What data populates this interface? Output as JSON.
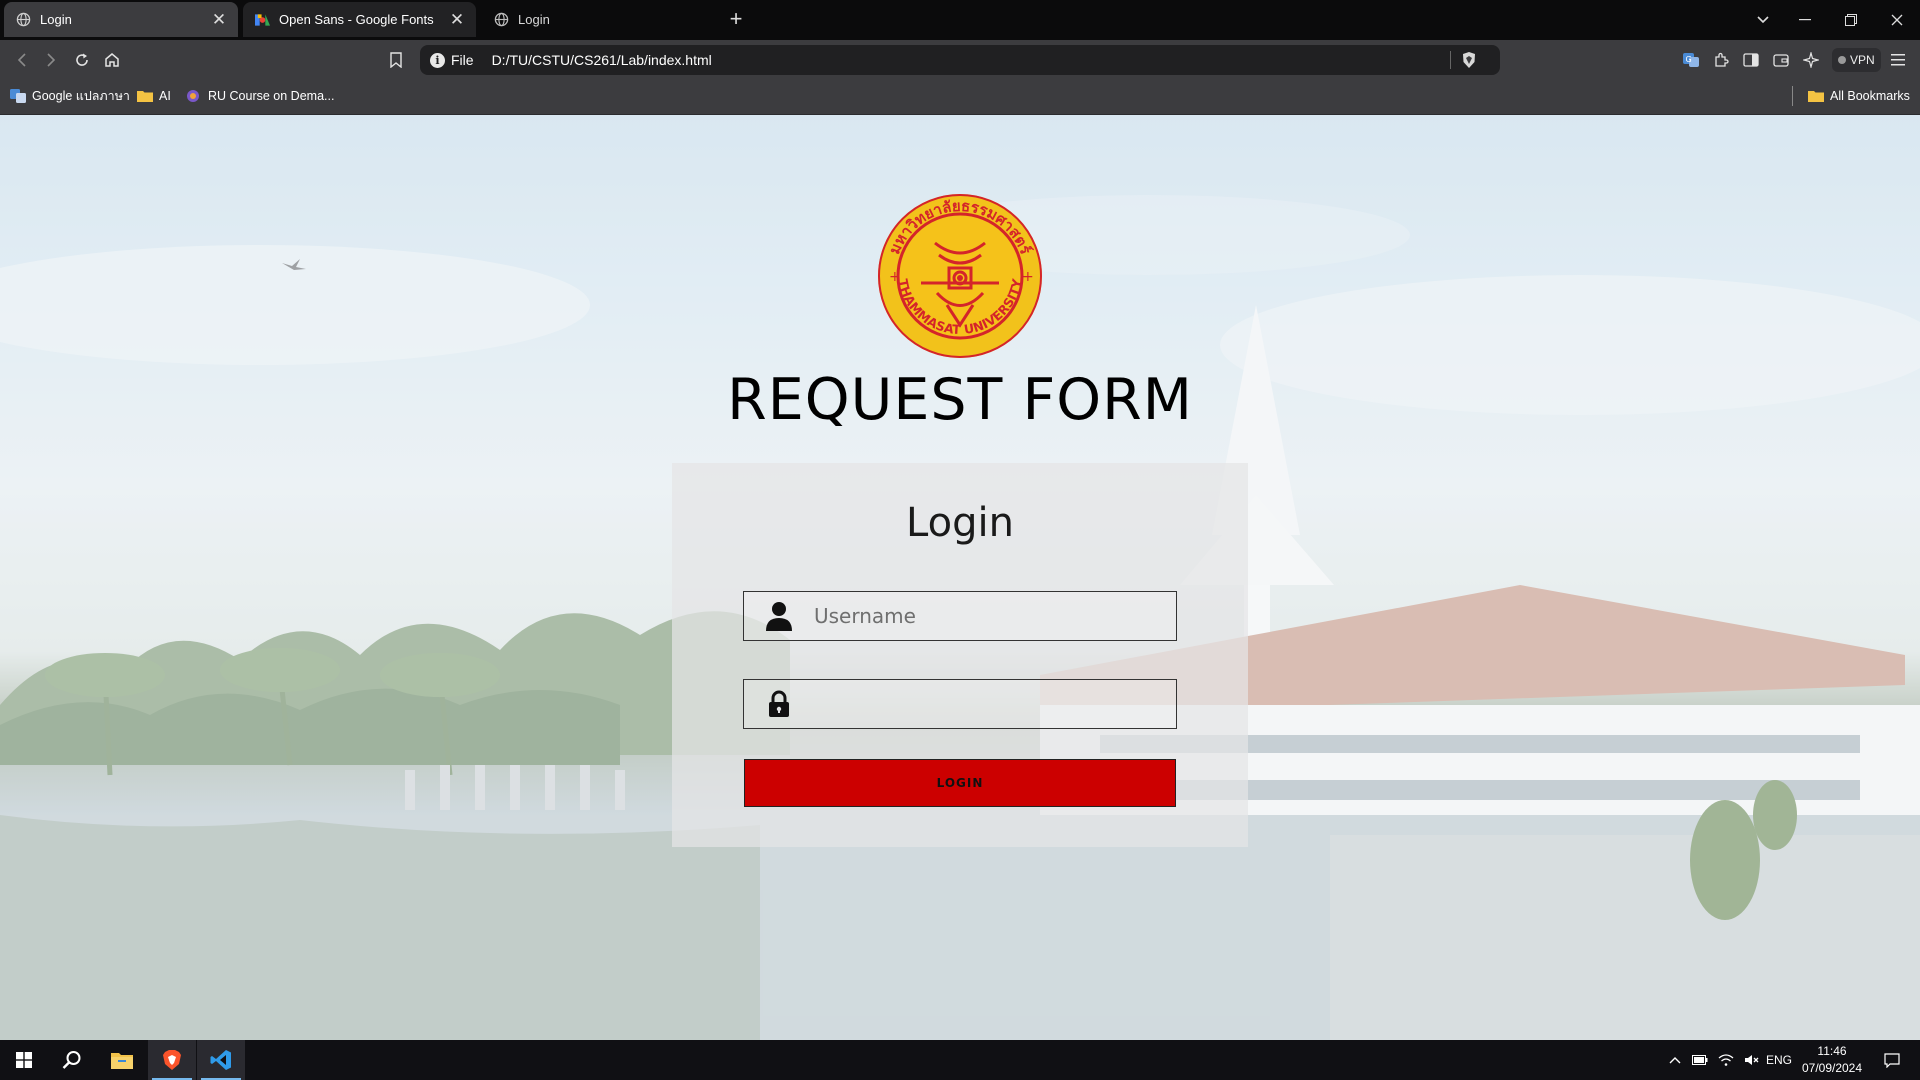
{
  "browser": {
    "tabs": [
      {
        "label": "Login",
        "active": true
      },
      {
        "label": "Open Sans - Google Fonts",
        "active": false
      },
      {
        "label": "Login",
        "active": false
      }
    ],
    "address": {
      "scheme_label": "File",
      "url": "D:/TU/CSTU/CS261/Lab/index.html"
    },
    "vpn_label": "VPN",
    "bookmarks": [
      {
        "label": "Google แปลภาษา",
        "icon": "google-translate-icon"
      },
      {
        "label": "AI",
        "icon": "folder-icon"
      },
      {
        "label": "RU Course on Dema...",
        "icon": "site-icon"
      }
    ],
    "all_bookmarks_label": "All Bookmarks"
  },
  "page": {
    "logo_alt": "Thammasat University seal",
    "logo_text": "THAMMASAT UNIVERSITY",
    "logo_thai_text": "มหาวิทยาลัยธรรมศาสตร์",
    "title": "REQUEST FORM",
    "login_card": {
      "heading": "Login",
      "username_placeholder": "Username",
      "password_placeholder": "",
      "button_label": "LOGIN"
    }
  },
  "taskbar": {
    "apps": [
      "start-icon",
      "search-icon",
      "file-explorer-icon",
      "brave-icon",
      "vscode-icon"
    ],
    "language": "ENG",
    "time": "11:46",
    "date": "07/09/2024"
  },
  "colors": {
    "login_button": "#cc0000",
    "seal_yellow": "#f2c21b",
    "seal_red": "#d4242a"
  }
}
